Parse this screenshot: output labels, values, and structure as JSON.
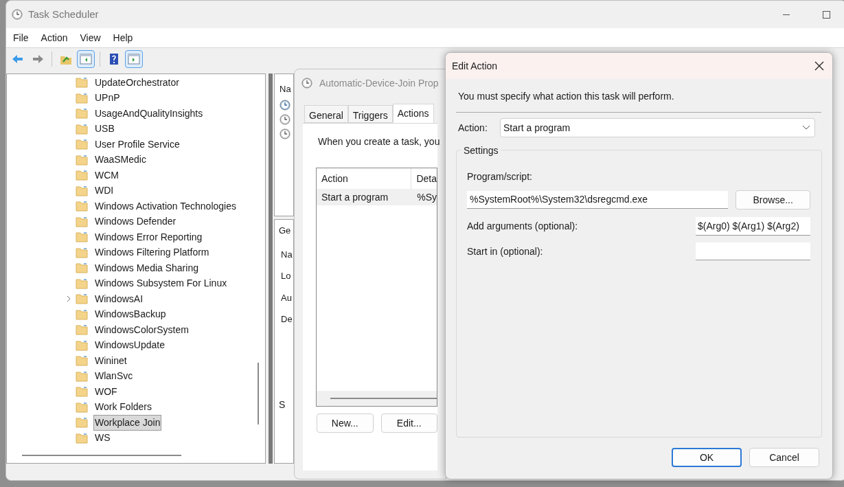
{
  "window": {
    "title": "Task Scheduler"
  },
  "menu": [
    "File",
    "Action",
    "View",
    "Help"
  ],
  "toolbar": [
    [
      {
        "kind": "back",
        "pressed": false
      },
      {
        "kind": "forward",
        "pressed": false
      }
    ],
    [
      {
        "kind": "up",
        "pressed": false
      },
      {
        "kind": "tree",
        "pressed": true
      }
    ],
    [
      {
        "kind": "help",
        "pressed": false
      },
      {
        "kind": "actions",
        "pressed": true
      }
    ]
  ],
  "tree": {
    "items": [
      {
        "label": "UpdateOrchestrator",
        "expandable": false,
        "selected": false
      },
      {
        "label": "UPnP",
        "expandable": false,
        "selected": false
      },
      {
        "label": "UsageAndQualityInsights",
        "expandable": false,
        "selected": false
      },
      {
        "label": "USB",
        "expandable": false,
        "selected": false
      },
      {
        "label": "User Profile Service",
        "expandable": false,
        "selected": false
      },
      {
        "label": "WaaSMedic",
        "expandable": false,
        "selected": false
      },
      {
        "label": "WCM",
        "expandable": false,
        "selected": false
      },
      {
        "label": "WDI",
        "expandable": false,
        "selected": false
      },
      {
        "label": "Windows Activation Technologies",
        "expandable": false,
        "selected": false
      },
      {
        "label": "Windows Defender",
        "expandable": false,
        "selected": false
      },
      {
        "label": "Windows Error Reporting",
        "expandable": false,
        "selected": false
      },
      {
        "label": "Windows Filtering Platform",
        "expandable": false,
        "selected": false
      },
      {
        "label": "Windows Media Sharing",
        "expandable": false,
        "selected": false
      },
      {
        "label": "Windows Subsystem For Linux",
        "expandable": false,
        "selected": false
      },
      {
        "label": "WindowsAI",
        "expandable": true,
        "selected": false
      },
      {
        "label": "WindowsBackup",
        "expandable": false,
        "selected": false
      },
      {
        "label": "WindowsColorSystem",
        "expandable": false,
        "selected": false
      },
      {
        "label": "WindowsUpdate",
        "expandable": false,
        "selected": false
      },
      {
        "label": "Wininet",
        "expandable": false,
        "selected": false
      },
      {
        "label": "WlanSvc",
        "expandable": false,
        "selected": false
      },
      {
        "label": "WOF",
        "expandable": false,
        "selected": false
      },
      {
        "label": "Work Folders",
        "expandable": false,
        "selected": false
      },
      {
        "label": "Workplace Join",
        "expandable": false,
        "selected": true
      },
      {
        "label": "WS",
        "expandable": false,
        "selected": false
      }
    ]
  },
  "task_list": {
    "column_1": "Na"
  },
  "details": {
    "tab": "Ge",
    "labels": [
      "Na",
      "Lo",
      "Au",
      "De"
    ],
    "group": "S"
  },
  "properties_dialog": {
    "title": "Automatic-Device-Join Prop",
    "tabs": [
      {
        "label": "General",
        "selected": false
      },
      {
        "label": "Triggers",
        "selected": false
      },
      {
        "label": "Actions",
        "selected": true
      }
    ],
    "intro": "When you create a task, you",
    "table": {
      "columns": [
        "Action",
        "Deta"
      ],
      "rows": [
        {
          "cells": [
            "Start a program",
            "%Sy"
          ],
          "selected": true
        }
      ]
    },
    "buttons": [
      "New...",
      "Edit..."
    ]
  },
  "edit_action": {
    "title": "Edit Action",
    "instruction": "You must specify what action this task will perform.",
    "action": {
      "label": "Action:",
      "value": "Start a program"
    },
    "settings": {
      "title": "Settings",
      "program": {
        "label": "Program/script:",
        "value": "%SystemRoot%\\System32\\dsregcmd.exe"
      },
      "browse": "Browse...",
      "arguments": {
        "label": "Add arguments (optional):",
        "value": "$(Arg0) $(Arg1) $(Arg2)"
      },
      "start_in": {
        "label": "Start in (optional):"
      }
    },
    "buttons": [
      {
        "label": "OK",
        "default": true
      },
      {
        "label": "Cancel",
        "default": false
      }
    ]
  }
}
